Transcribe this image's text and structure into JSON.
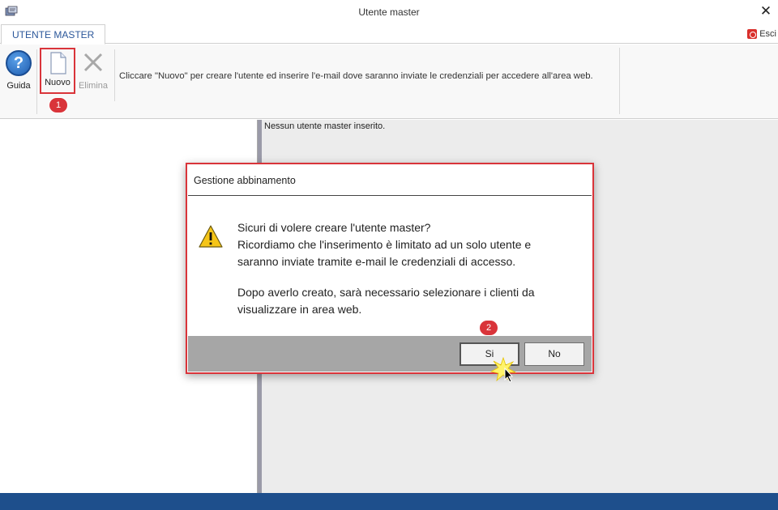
{
  "window": {
    "title": "Utente master",
    "close_label": "✕"
  },
  "ribbon": {
    "tab_label": "UTENTE MASTER",
    "exit_label": "Esci",
    "buttons": {
      "guida": "Guida",
      "nuovo": "Nuovo",
      "elimina": "Elimina"
    },
    "hint": "Cliccare \"Nuovo\" per creare l'utente ed inserire l'e-mail dove saranno inviate le credenziali per accedere all'area web."
  },
  "content": {
    "empty_message": "Nessun utente master inserito."
  },
  "dialog": {
    "title": "Gestione abbinamento",
    "lines": [
      "Sicuri di volere creare l'utente master?",
      "Ricordiamo che l'inserimento è limitato ad un solo utente e",
      "saranno inviate tramite e-mail le credenziali di accesso.",
      "Dopo averlo creato, sarà necessario selezionare i clienti da",
      "visualizzare in area web."
    ],
    "yes_label": "Si",
    "no_label": "No"
  },
  "annotations": {
    "step1": "1",
    "step2": "2"
  },
  "colors": {
    "highlight_red": "#d9343a",
    "status_bar": "#1e4f8c",
    "tab_text": "#2b579a"
  }
}
